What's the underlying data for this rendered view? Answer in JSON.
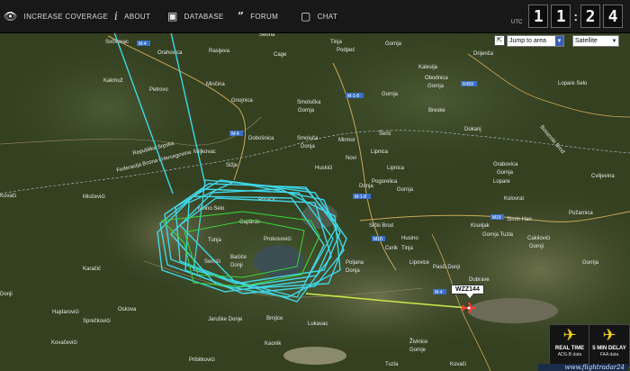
{
  "nav": [
    {
      "label": "INCREASE COVERAGE",
      "icon": "eye-icon"
    },
    {
      "label": "ABOUT",
      "icon": "info-icon"
    },
    {
      "label": "DATABASE",
      "icon": "database-icon"
    },
    {
      "label": "FORUM",
      "icon": "quote-icon"
    },
    {
      "label": "CHAT",
      "icon": "chat-bubble-icon"
    }
  ],
  "clock": {
    "utc": "UTC",
    "h1": "1",
    "h2": "1",
    "m1": "2",
    "m2": "4"
  },
  "controls": {
    "jump_to_area": "Jump to area",
    "map_type": "Satellite"
  },
  "flight": {
    "callsign": "WZZ144"
  },
  "badges": [
    {
      "title": "REAL TIME",
      "sub": "ADS-B data"
    },
    {
      "title": "5 MIN DELAY",
      "sub": "FAA data"
    }
  ],
  "logo": "www.flightradar24",
  "roads": [
    "M-4",
    "M-4",
    "M-1-8",
    "M-1-8",
    "M18",
    "M18",
    "R459",
    "M-4"
  ],
  "places": [
    "Sočkovac",
    "Orahovica",
    "Rasijeva",
    "Cage",
    "Seona",
    "Tinja",
    "Podpeć",
    "Drijenča",
    "Gornja",
    "Kakmuž",
    "Petrovo",
    "Minčina",
    "Gnojnica",
    "Miljkovac",
    "Smolučka",
    "Gornja",
    "Gornja",
    "Kalesija",
    "Obodnica",
    "Gornja",
    "Lopare Selo",
    "Dobošnica",
    "Smoluča",
    "Donja",
    "Breske",
    "Dokanj",
    "Republika Srpska",
    "Federacija Bosna i Hercegovina",
    "Šerić",
    "Mirmor",
    "Novi",
    "Lipnica",
    "Grabovica",
    "Gornja",
    "Sižje",
    "Huskići",
    "Lipnica",
    "Donja",
    "Lopare",
    "Bosanski Brod",
    "Miočevići",
    "Kovači",
    "Milino Selo",
    "Pogorelica",
    "Gornja",
    "Kolovrat",
    "Puračić",
    "Caparde",
    "Tunja",
    "Prokosovići",
    "Semići",
    "Baćiće",
    "Donji",
    "Sički Brod",
    "Husino",
    "Simin Han",
    "Tinja",
    "Cerik",
    "Lipovice",
    "Poljana",
    "Donja",
    "Kiseljak",
    "Gornja Tuzla",
    "Cviljevina",
    "Požarnica",
    "Cakilovići",
    "Gornji",
    "Dubrave",
    "Gornja",
    "Karačić",
    "Pasči Donji",
    "Donji",
    "Hajdarovići",
    "Oskova",
    "Sprečkovići",
    "Kovačevići",
    "Jaruške Donje",
    "Brnjice",
    "Lukavac",
    "Kaonik",
    "Živinice",
    "Gornje",
    "Tuzla",
    "Kovači",
    "Pribitkovići"
  ]
}
